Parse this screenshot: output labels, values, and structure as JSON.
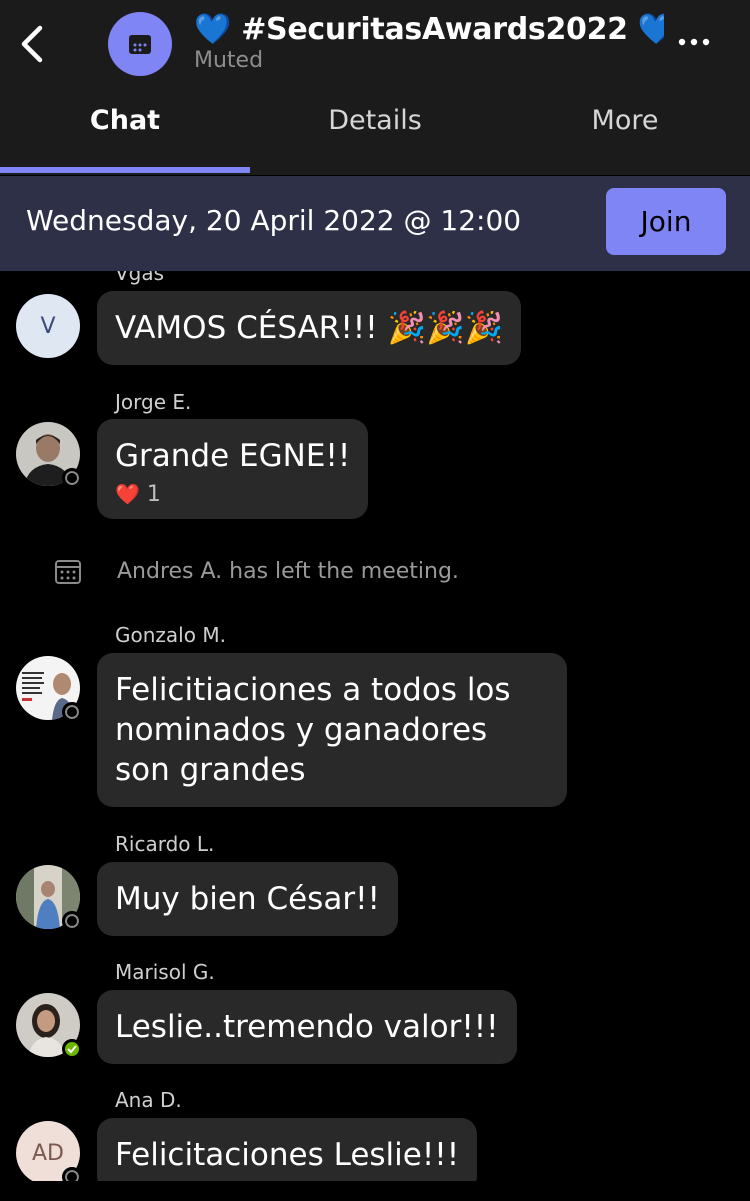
{
  "header": {
    "title": "💙 #SecuritasAwards2022 💙…",
    "subtitle": "Muted",
    "back_icon": "chevron-left-icon",
    "group_icon": "calendar-icon",
    "more_icon": "more-horizontal-icon"
  },
  "tabs": [
    {
      "label": "Chat",
      "active": true
    },
    {
      "label": "Details",
      "active": false
    },
    {
      "label": "More",
      "active": false
    }
  ],
  "banner": {
    "text": "Wednesday, 20 April 2022 @ 12:00",
    "join_label": "Join"
  },
  "messages": [
    {
      "sender": "Vgas",
      "initials": "V",
      "text": "VAMOS CÉSAR!!! 🎉🎉🎉",
      "presence": "none"
    },
    {
      "sender": "Jorge E.",
      "text": "Grande EGNE!!",
      "reaction": "❤️",
      "reaction_count": "1",
      "presence": "offline"
    },
    {
      "system": "Andres A. has left the meeting."
    },
    {
      "sender": "Gonzalo M.",
      "text": "Felicitiaciones a todos los nominados y ganadores son grandes",
      "presence": "offline"
    },
    {
      "sender": "Ricardo L.",
      "text": "Muy bien César!!",
      "presence": "offline"
    },
    {
      "sender": "Marisol G.",
      "text": "Leslie..tremendo valor!!!",
      "presence": "online"
    },
    {
      "sender": "Ana D.",
      "initials": "AD",
      "text": "Felicitaciones Leslie!!!",
      "presence": "offline"
    }
  ],
  "colors": {
    "accent": "#7f85f5",
    "header_bg": "#1b1b1b",
    "banner_bg": "#2e3048",
    "bubble_bg": "#292929",
    "online": "#6bb700"
  }
}
